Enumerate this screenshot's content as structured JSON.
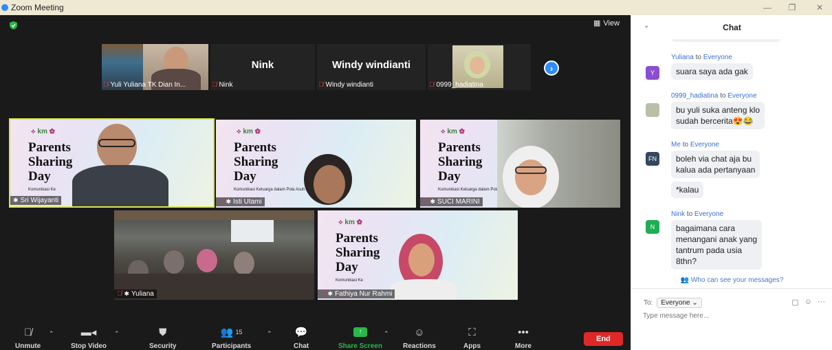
{
  "window": {
    "title": "Zoom Meeting",
    "minimize": "—",
    "restore": "❐",
    "close": "✕"
  },
  "meeting": {
    "view_label": "View",
    "strip": [
      {
        "name_label": "Yuli Yuliana TK Dian In...",
        "display": ""
      },
      {
        "name_label": "Nink",
        "display": "Nink"
      },
      {
        "name_label": "Windy windianti",
        "display": "Windy windianti"
      },
      {
        "name_label": "0999_hadiatina",
        "display": ""
      }
    ],
    "slide": {
      "logo": "km",
      "line1": "Parents",
      "line2": "Sharing",
      "line3": "Day",
      "caption_full": "Komunikasi Keluarga dalam Pola Asuh Anak",
      "caption_short": "Komunikasi Ke"
    },
    "tiles": [
      {
        "name": "Sri Wijayanti"
      },
      {
        "name": "Isti Utami"
      },
      {
        "name": "SUCI MARINI"
      },
      {
        "name": "Yuliana"
      },
      {
        "name": "Fathiya Nur Rahmi"
      }
    ]
  },
  "toolbar": {
    "unmute": "Unmute",
    "stop_video": "Stop Video",
    "security": "Security",
    "participants": "Participants",
    "participants_count": "15",
    "chat": "Chat",
    "share_screen": "Share Screen",
    "reactions": "Reactions",
    "apps": "Apps",
    "more": "More",
    "end": "End"
  },
  "chat": {
    "title": "Chat",
    "messages": [
      {
        "sender": "Yuliana",
        "to": "to",
        "recipient": "Everyone",
        "avatar": "Y",
        "avatar_color": "#8a4fd1",
        "lines": [
          "suara saya ada gak"
        ]
      },
      {
        "sender": "0999_hadiatina",
        "to": "to",
        "recipient": "Everyone",
        "avatar": "",
        "avatar_color": "#b9c0a8",
        "lines": [
          "bu yuli suka anteng klo",
          "sudah bercerita😍😂"
        ]
      },
      {
        "sender": "Me",
        "to": "to",
        "recipient": "Everyone",
        "avatar": "FN",
        "avatar_color": "#34475e",
        "lines": [
          "boleh via chat aja bu",
          "kalua ada pertanyaan"
        ]
      },
      {
        "sender": "",
        "to": "",
        "recipient": "",
        "avatar": "",
        "avatar_color": "",
        "lines": [
          "*kalau"
        ]
      },
      {
        "sender": "Nink",
        "to": "to",
        "recipient": "Everyone",
        "avatar": "N",
        "avatar_color": "#1fae52",
        "lines": [
          "bagaimana cara",
          "menangani anak yang",
          "tantrum pada usia",
          "8thn?"
        ]
      }
    ],
    "who_can_see": "Who can see your messages?",
    "to_label": "To:",
    "to_value": "Everyone",
    "input_placeholder": "Type message here..."
  }
}
